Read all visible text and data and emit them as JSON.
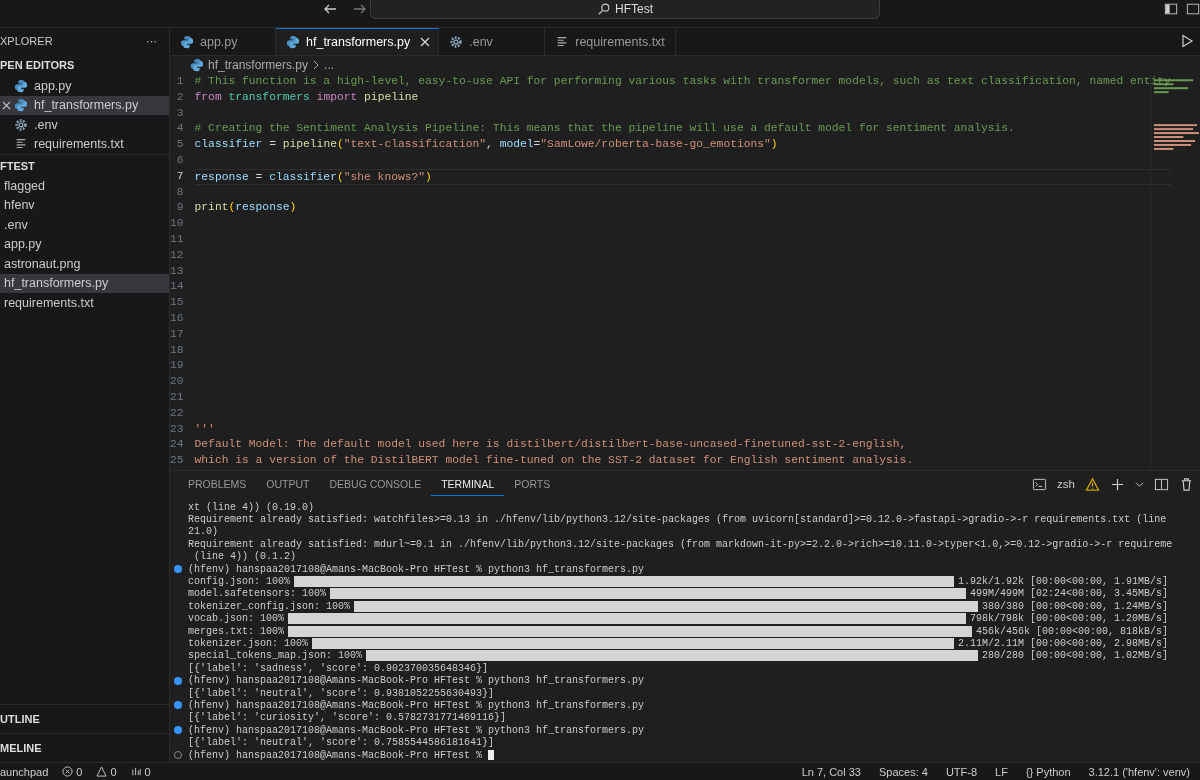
{
  "title_bar": {
    "search": "HFTest"
  },
  "sidebar": {
    "title": "XPLORER",
    "more": "···",
    "open_editors": {
      "title": "PEN EDITORS",
      "items": [
        {
          "label": "app.py",
          "kind": "python",
          "selected": false
        },
        {
          "label": "hf_transformers.py",
          "kind": "python",
          "selected": true
        },
        {
          "label": ".env",
          "kind": "gear",
          "selected": false
        },
        {
          "label": "requirements.txt",
          "kind": "lines",
          "selected": false
        }
      ]
    },
    "folder": {
      "title": "FTEST",
      "items": [
        {
          "label": "flagged",
          "selected": false
        },
        {
          "label": "hfenv",
          "selected": false
        },
        {
          "label": ".env",
          "selected": false
        },
        {
          "label": "app.py",
          "selected": false
        },
        {
          "label": "astronaut.png",
          "selected": false
        },
        {
          "label": "hf_transformers.py",
          "selected": true
        },
        {
          "label": "requirements.txt",
          "selected": false
        }
      ]
    },
    "sections": [
      "UTLINE",
      "MELINE"
    ]
  },
  "tabs": [
    {
      "label": "app.py",
      "kind": "python",
      "selected": false
    },
    {
      "label": "hf_transformers.py",
      "kind": "python",
      "selected": true
    },
    {
      "label": ".env",
      "kind": "gear",
      "selected": false
    },
    {
      "label": "requirements.txt",
      "kind": "lines",
      "selected": false
    }
  ],
  "breadcrumb": {
    "file": "hf_transformers.py",
    "rest": "..."
  },
  "editor": {
    "lines": [
      {
        "no": "1",
        "current": false,
        "tokens": [
          {
            "kind": "comment",
            "text": "# This function is a high-level, easy-to-use API for performing various tasks with transformer models, such as text classification, named entity"
          }
        ]
      },
      {
        "no": "2",
        "current": false,
        "tokens": [
          {
            "kind": "keyword",
            "text": "from "
          },
          {
            "kind": "module",
            "text": "transformers "
          },
          {
            "kind": "keyword",
            "text": "import "
          },
          {
            "kind": "func",
            "text": "pipeline"
          }
        ]
      },
      {
        "no": "3",
        "current": false
      },
      {
        "no": "4",
        "current": false,
        "tokens": [
          {
            "kind": "comment",
            "text": "# Creating the Sentiment Analysis Pipeline: This means that the pipeline will use a default model for sentiment analysis."
          }
        ]
      },
      {
        "no": "5",
        "current": false,
        "tokens": [
          {
            "kind": "var",
            "text": "classifier"
          },
          {
            "kind": "plain",
            "text": " = "
          },
          {
            "kind": "func",
            "text": "pipeline"
          },
          {
            "kind": "paren",
            "text": "("
          },
          {
            "kind": "string",
            "text": "\"text-classification\""
          },
          {
            "kind": "plain",
            "text": ", "
          },
          {
            "kind": "var",
            "text": "model"
          },
          {
            "kind": "plain",
            "text": "="
          },
          {
            "kind": "string",
            "text": "\"SamLowe/roberta-base-go_emotions\""
          },
          {
            "kind": "paren",
            "text": ")"
          }
        ]
      },
      {
        "no": "6",
        "current": false
      },
      {
        "no": "7",
        "current": true,
        "tokens": [
          {
            "kind": "var",
            "text": "response"
          },
          {
            "kind": "plain",
            "text": " = "
          },
          {
            "kind": "var",
            "text": "classifier"
          },
          {
            "kind": "paren",
            "text": "("
          },
          {
            "kind": "string",
            "text": "\"she knows?\""
          },
          {
            "kind": "paren",
            "text": ")"
          }
        ]
      },
      {
        "no": "8",
        "current": false
      },
      {
        "no": "9",
        "current": false,
        "tokens": [
          {
            "kind": "func",
            "text": "print"
          },
          {
            "kind": "paren",
            "text": "("
          },
          {
            "kind": "var",
            "text": "response"
          },
          {
            "kind": "paren",
            "text": ")"
          }
        ]
      },
      {
        "no": "10",
        "current": false
      },
      {
        "no": "11",
        "current": false
      },
      {
        "no": "12",
        "current": false
      },
      {
        "no": "13",
        "current": false
      },
      {
        "no": "14",
        "current": false
      },
      {
        "no": "15",
        "current": false
      },
      {
        "no": "16",
        "current": false
      },
      {
        "no": "17",
        "current": false
      },
      {
        "no": "18",
        "current": false
      },
      {
        "no": "19",
        "current": false
      },
      {
        "no": "20",
        "current": false
      },
      {
        "no": "21",
        "current": false
      },
      {
        "no": "22",
        "current": false
      },
      {
        "no": "23",
        "current": false,
        "tokens": [
          {
            "kind": "string",
            "text": "'''"
          }
        ]
      },
      {
        "no": "24",
        "current": false,
        "tokens": [
          {
            "kind": "string",
            "text": "Default Model: The default model used here is distilbert/distilbert-base-uncased-finetuned-sst-2-english,"
          }
        ]
      },
      {
        "no": "25",
        "current": false,
        "tokens": [
          {
            "kind": "string",
            "text": "which is a version of the DistilBERT model fine-tuned on the SST-2 dataset for English sentiment analysis."
          }
        ]
      }
    ]
  },
  "panel": {
    "tabs": [
      {
        "label": "PROBLEMS",
        "selected": false
      },
      {
        "label": "OUTPUT",
        "selected": false
      },
      {
        "label": "DEBUG CONSOLE",
        "selected": false
      },
      {
        "label": "TERMINAL",
        "selected": true
      },
      {
        "label": "PORTS",
        "selected": false
      }
    ],
    "shell": "zsh",
    "terminal": [
      {
        "kind": "text",
        "text": "xt (line 4)) (0.19.0)"
      },
      {
        "kind": "text",
        "text": "Requirement already satisfied: watchfiles>=0.13 in ./hfenv/lib/python3.12/site-packages (from uvicorn[standard]>=0.12.0->fastapi->gradio->-r requirements.txt (line"
      },
      {
        "kind": "text",
        "text": "21.0)"
      },
      {
        "kind": "text",
        "text": "Requirement already satisfied: mdurl~=0.1 in ./hfenv/lib/python3.12/site-packages (from markdown-it-py>=2.2.0->rich>=10.11.0->typer<1.0,>=0.12->gradio->-r requireme"
      },
      {
        "kind": "text",
        "text": " (line 4)) (0.1.2)"
      },
      {
        "kind": "prompt",
        "done": true,
        "text": "(hfenv) hanspaa2017108@Amans-MacBook-Pro HFTest % python3 hf_transformers.py"
      },
      {
        "kind": "progress",
        "label": "config.json: 100%",
        "level": 1,
        "reading": "1.92k/1.92k [00:00<00:00, 1.91MB/s]"
      },
      {
        "kind": "progress",
        "label": "model.safetensors: 100%",
        "level": 1,
        "reading": "499M/499M [02:24<00:00, 3.45MB/s]"
      },
      {
        "kind": "progress",
        "label": "tokenizer_config.json: 100%",
        "level": 1,
        "reading": "380/380 [00:00<00:00, 1.24MB/s]"
      },
      {
        "kind": "progress",
        "label": "vocab.json: 100%",
        "level": 1,
        "reading": "798k/798k [00:00<00:00, 1.20MB/s]"
      },
      {
        "kind": "progress",
        "label": "merges.txt: 100%",
        "level": 1,
        "reading": "456k/456k [00:00<00:00, 818kB/s]"
      },
      {
        "kind": "progress",
        "label": "tokenizer.json: 100%",
        "level": 1,
        "reading": "2.11M/2.11M [00:00<00:00, 2.98MB/s]"
      },
      {
        "kind": "progress",
        "label": "special_tokens_map.json: 100%",
        "level": 1,
        "reading": "280/280 [00:00<00:00, 1.02MB/s]"
      },
      {
        "kind": "text",
        "text": "[{'label': 'sadness', 'score': 0.902370035648346}]"
      },
      {
        "kind": "prompt",
        "done": true,
        "text": "(hfenv) hanspaa2017108@Amans-MacBook-Pro HFTest % python3 hf_transformers.py"
      },
      {
        "kind": "text",
        "text": "[{'label': 'neutral', 'score': 0.9381052255630493}]"
      },
      {
        "kind": "prompt",
        "done": true,
        "text": "(hfenv) hanspaa2017108@Amans-MacBook-Pro HFTest % python3 hf_transformers.py"
      },
      {
        "kind": "text",
        "text": "[{'label': 'curiosity', 'score': 0.5782731771469116}]"
      },
      {
        "kind": "prompt",
        "done": true,
        "text": "(hfenv) hanspaa2017108@Amans-MacBook-Pro HFTest % python3 hf_transformers.py"
      },
      {
        "kind": "text",
        "text": "[{'label': 'neutral', 'score': 0.7585544586181641}]"
      },
      {
        "kind": "prompt",
        "done": false,
        "cursor": true,
        "text": "(hfenv) hanspaa2017108@Amans-MacBook-Pro HFTest %"
      }
    ]
  },
  "status_bar": {
    "left": [
      {
        "kind": "text",
        "text": "aunchpad"
      },
      {
        "kind": "error",
        "text": "0"
      },
      {
        "kind": "warning",
        "text": "0"
      },
      {
        "kind": "ports",
        "text": "0"
      }
    ],
    "right": [
      "Ln 7, Col 33",
      "Spaces: 4",
      "UTF-8",
      "LF",
      "{} Python",
      "3.12.1 ('hfenv': venv)"
    ]
  }
}
